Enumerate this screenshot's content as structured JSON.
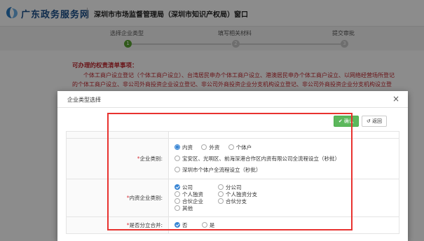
{
  "header": {
    "site_name": "广东政务服务网",
    "bureau_name": "深圳市市场监督管理局（深圳市知识产权局）窗口"
  },
  "steps": [
    {
      "label": "选择企业类型",
      "number": "1",
      "active": true
    },
    {
      "label": "填写相关材料",
      "number": "2",
      "active": false
    },
    {
      "label": "提交审批",
      "number": "3",
      "active": false
    }
  ],
  "notice": {
    "title": "可办理的权责清单事项：",
    "line1": "个体工商户设立登记（个体工商户设立）、台湾居民申办个体工商户设立、港澳居民申办个体工商户设立、以网络经营场所登记",
    "line2": "的个体工商户设立、非公司外商投资企业设立登记、非公司外商投资企业分支机构设立登记、非公司外商投资企业分支机构设立登"
  },
  "modal": {
    "title": "企业类型选择",
    "close": "×",
    "confirm_label": "确认",
    "back_label": "返回"
  },
  "form": {
    "enterprise_category": {
      "label": "企业类别:",
      "options": [
        "内资",
        "外资",
        "个体户"
      ],
      "extra_options": [
        "宝安区、光明区、前海深港合作区内资有限公司全流程设立（秒批）",
        "深圳市个体户全流程设立（秒批）"
      ],
      "selected": "内资"
    },
    "domestic_category": {
      "label": "内资企业类别:",
      "options": [
        "公司",
        "分公司",
        "个人独资",
        "个人独资分支",
        "合伙企业",
        "合伙分支",
        "其他"
      ],
      "selected": "公司"
    },
    "split_merge": {
      "label": "是否分立合并:",
      "options": [
        "否",
        "是"
      ],
      "selected": "否"
    }
  },
  "colors": {
    "brand": "#1b4f8a",
    "active_step": "#5aa532",
    "notice_text": "#c0262d",
    "confirm_button": "#5cb85c",
    "selected_radio": "#3a86d4",
    "highlight_box": "#e8322f"
  },
  "icons": {
    "logo": "government-service-logo-icon",
    "close": "close-icon",
    "confirm": "check-icon",
    "back": "return-arrow-icon"
  }
}
